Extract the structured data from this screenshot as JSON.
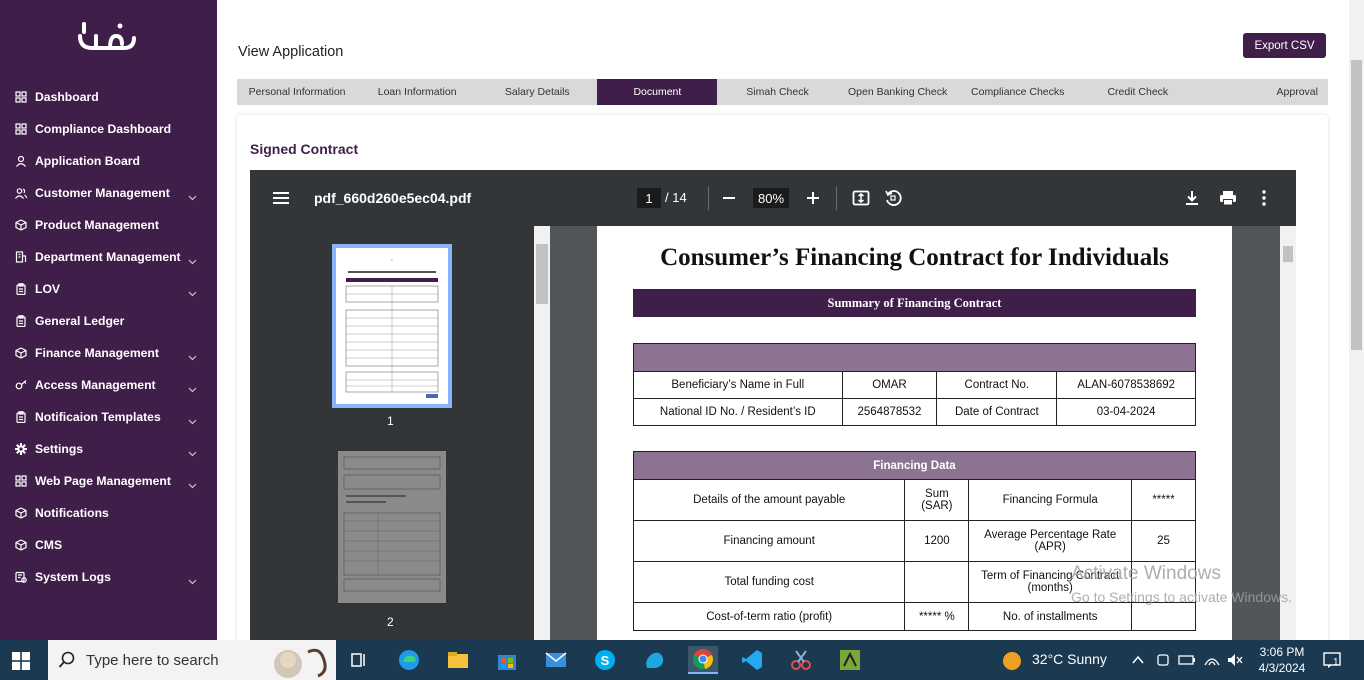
{
  "sidebar": {
    "logo_text": "عون",
    "items": [
      {
        "label": "Dashboard",
        "icon": "grid-icon",
        "has_chevron": false
      },
      {
        "label": "Compliance Dashboard",
        "icon": "grid-icon",
        "has_chevron": false
      },
      {
        "label": "Application Board",
        "icon": "user-icon",
        "has_chevron": false
      },
      {
        "label": "Customer Management",
        "icon": "users-icon",
        "has_chevron": true
      },
      {
        "label": "Product Management",
        "icon": "box-icon",
        "has_chevron": false
      },
      {
        "label": "Department Management",
        "icon": "building-icon",
        "has_chevron": true
      },
      {
        "label": "LOV",
        "icon": "clipboard-icon",
        "has_chevron": true
      },
      {
        "label": "General Ledger",
        "icon": "clipboard-icon",
        "has_chevron": false
      },
      {
        "label": "Finance Management",
        "icon": "box-icon",
        "has_chevron": true
      },
      {
        "label": "Access Management",
        "icon": "key-icon",
        "has_chevron": true
      },
      {
        "label": "Notificaion Templates",
        "icon": "clipboard-icon",
        "has_chevron": true
      },
      {
        "label": "Settings",
        "icon": "gear-icon",
        "has_chevron": true
      },
      {
        "label": "Web Page Management",
        "icon": "grid-icon",
        "has_chevron": true
      },
      {
        "label": "Notifications",
        "icon": "box-icon",
        "has_chevron": false
      },
      {
        "label": "CMS",
        "icon": "box-icon",
        "has_chevron": false
      },
      {
        "label": "System Logs",
        "icon": "log-icon",
        "has_chevron": true
      }
    ]
  },
  "header": {
    "title": "View Application",
    "export_label": "Export CSV"
  },
  "tabs": [
    {
      "label": "Personal Information",
      "active": false
    },
    {
      "label": "Loan Information",
      "active": false
    },
    {
      "label": "Salary Details",
      "active": false
    },
    {
      "label": "Document",
      "active": true
    },
    {
      "label": "Simah Check",
      "active": false
    },
    {
      "label": "Open Banking Check",
      "active": false
    },
    {
      "label": "Compliance Checks",
      "active": false
    },
    {
      "label": "Credit Check",
      "active": false
    },
    {
      "label": "Approval",
      "active": false
    }
  ],
  "section": {
    "title": "Signed Contract"
  },
  "viewer": {
    "filename": "pdf_660d260e5ec04.pdf",
    "current_page": "1",
    "total_pages": "/ 14",
    "zoom": "80%",
    "thumbnails": [
      {
        "number": "1"
      },
      {
        "number": "2"
      }
    ]
  },
  "document": {
    "title": "Consumer’s Financing Contract for Individuals",
    "summary_band": "Summary of Financing Contract",
    "party_table": {
      "rows": [
        [
          "Beneficiary’s Name in Full",
          "OMAR",
          "Contract No.",
          "ALAN-6078538692"
        ],
        [
          "National ID No. / Resident’s ID",
          "2564878532",
          "Date of Contract",
          "03-04-2024"
        ]
      ]
    },
    "financing_table": {
      "header": "Financing Data",
      "rows": [
        [
          "Details of the amount payable",
          "Sum (SAR)",
          "Financing Formula",
          "*****"
        ],
        [
          "Financing amount",
          "1200",
          "Average Percentage Rate (APR)",
          "25"
        ],
        [
          "Total funding cost",
          "",
          "Term of Financing Contract (months)",
          ""
        ],
        [
          "Cost-of-term ratio (profit)",
          "***** %",
          "No. of installments",
          ""
        ]
      ]
    }
  },
  "watermark": {
    "line1": "Activate Windows",
    "line2": "Go to Settings to activate Windows."
  },
  "taskbar": {
    "search_placeholder": "Type here to search",
    "weather": "32°C  Sunny",
    "time": "3:06 PM",
    "date": "4/3/2024",
    "notification_count": "1"
  },
  "colors": {
    "brand": "#3f1f49",
    "table_header": "#8c7391"
  }
}
